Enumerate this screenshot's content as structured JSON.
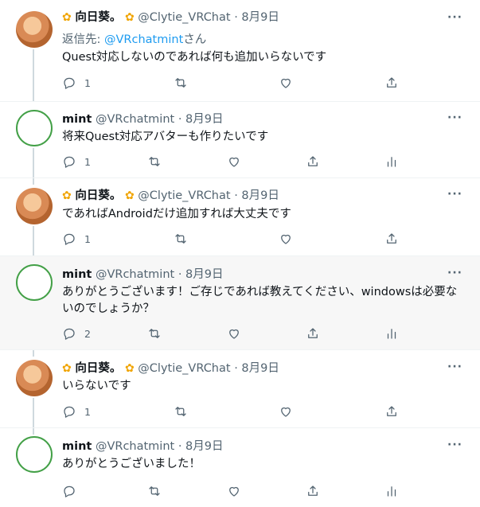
{
  "tweets": [
    {
      "kind": "sun",
      "display_name": "向日葵。",
      "handle": "@Clytie_VRChat",
      "sep": "·",
      "date": "8月9日",
      "reply_prefix": "返信先: ",
      "reply_handle": "@VRchatmint",
      "reply_suffix": "さん",
      "text": "Quest対応しないのであれば何も追加いらないです",
      "replies": "1"
    },
    {
      "kind": "mint",
      "display_name": "mint",
      "handle": "@VRchatmint",
      "sep": "·",
      "date": "8月9日",
      "text": "将来Quest対応アバターも作りたいです",
      "replies": "1"
    },
    {
      "kind": "sun",
      "display_name": "向日葵。",
      "handle": "@Clytie_VRChat",
      "sep": "·",
      "date": "8月9日",
      "text": "であればAndroidだけ追加すれば大丈夫です",
      "replies": "1"
    },
    {
      "kind": "mint",
      "display_name": "mint",
      "handle": "@VRchatmint",
      "sep": "·",
      "date": "8月9日",
      "text": "ありがとうございます！ご存じであれば教えてください、windowsは必要ないのでしょうか？",
      "replies": "2"
    },
    {
      "kind": "sun",
      "display_name": "向日葵。",
      "handle": "@Clytie_VRChat",
      "sep": "·",
      "date": "8月9日",
      "text": "いらないです",
      "replies": "1"
    },
    {
      "kind": "mint",
      "display_name": "mint",
      "handle": "@VRchatmint",
      "sep": "·",
      "date": "8月9日",
      "text": "ありがとうございました！",
      "replies": ""
    }
  ],
  "more_label": "···",
  "colors": {
    "link": "#1d9bf0",
    "muted": "#536471",
    "highlight": "#f7f7f7",
    "thread": "#cfd9de"
  },
  "icons": [
    "reply-icon",
    "retweet-icon",
    "like-icon",
    "share-icon",
    "analytics-icon",
    "more-icon",
    "sunflower-emoji"
  ]
}
